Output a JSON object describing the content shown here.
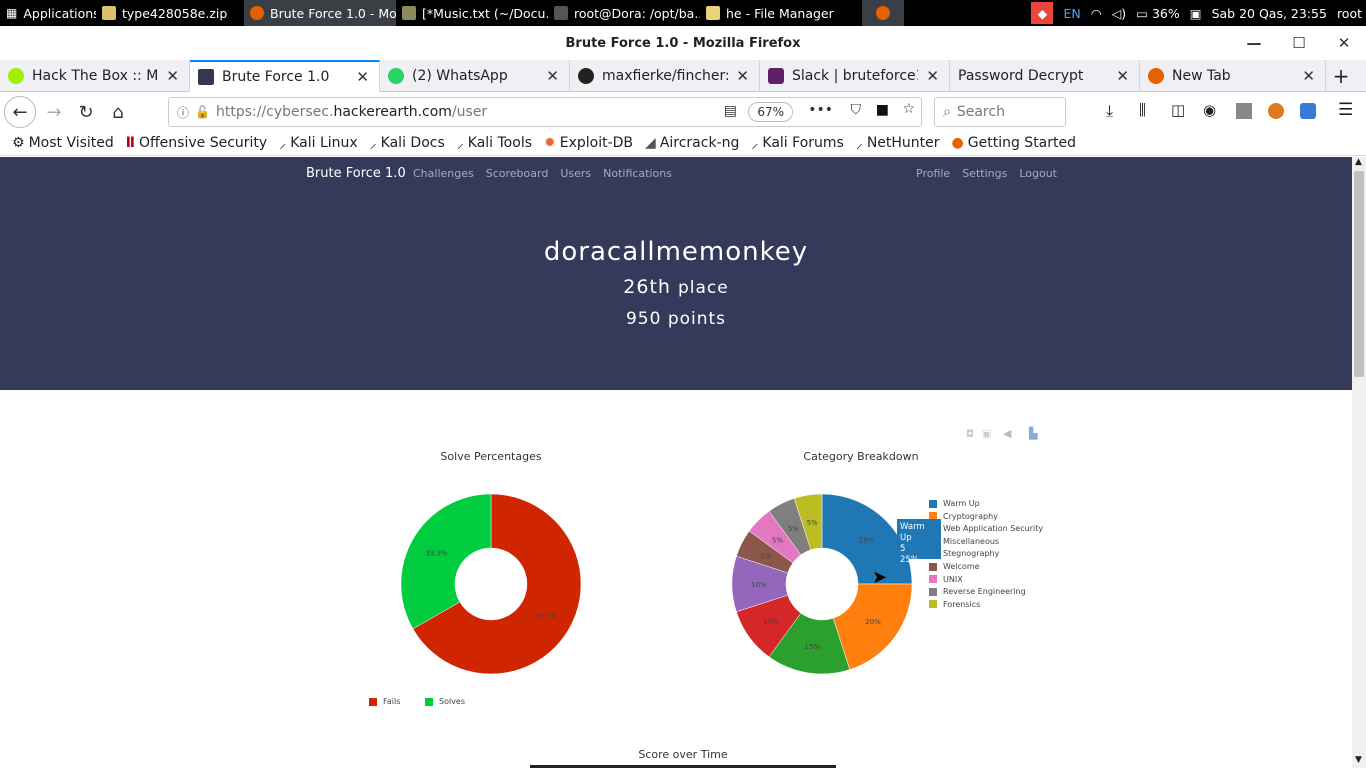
{
  "taskbar": {
    "apps_label": "Applications",
    "items": [
      {
        "label": "type428058e.zip",
        "color": "#d9c36a"
      },
      {
        "label": "Brute Force 1.0 - Mo...",
        "color": "#e66000"
      },
      {
        "label": "[*Music.txt (~/Docu...",
        "color": "#8a8a5a"
      },
      {
        "label": "root@Dora: /opt/ba...",
        "color": "#555555"
      },
      {
        "label": "he - File Manager",
        "color": "#e8d27a"
      }
    ],
    "lang": "EN",
    "battery": "36%",
    "clock": "Sab 20 Qas, 23:55",
    "user": "root"
  },
  "window": {
    "title": "Brute Force 1.0 - Mozilla Firefox"
  },
  "tabs": [
    {
      "label": "Hack The Box :: Ma",
      "color": "#9fef00"
    },
    {
      "label": "Brute Force 1.0",
      "color": "#323754"
    },
    {
      "label": "(2) WhatsApp",
      "color": "#25d366"
    },
    {
      "label": "maxfierke/fincher: A",
      "color": "#222222"
    },
    {
      "label": "Slack | bruteforce1-",
      "color": "#611f69"
    },
    {
      "label": "Password Decrypt",
      "color": ""
    },
    {
      "label": "New Tab",
      "color": "#e66000"
    }
  ],
  "url": {
    "prefix": "https://cybersec.",
    "host": "hackerearth.com",
    "path": "/user"
  },
  "zoom": "67%",
  "search_placeholder": "Search",
  "bookmarks": [
    {
      "label": "Most Visited",
      "icon": "gear-icon",
      "color": "#333333"
    },
    {
      "label": "Offensive Security",
      "icon": "offsec-icon",
      "color": "#b00020"
    },
    {
      "label": "Kali Linux",
      "icon": "kali-icon",
      "color": "#222222"
    },
    {
      "label": "Kali Docs",
      "icon": "kali-icon",
      "color": "#222222"
    },
    {
      "label": "Kali Tools",
      "icon": "kali-icon",
      "color": "#222222"
    },
    {
      "label": "Exploit-DB",
      "icon": "exploitdb-icon",
      "color": "#e8632b"
    },
    {
      "label": "Aircrack-ng",
      "icon": "aircrack-icon",
      "color": "#444444"
    },
    {
      "label": "Kali Forums",
      "icon": "kali-icon",
      "color": "#222222"
    },
    {
      "label": "NetHunter",
      "icon": "kali-icon",
      "color": "#222222"
    },
    {
      "label": "Getting Started",
      "icon": "firefox-icon",
      "color": "#e66000"
    }
  ],
  "site": {
    "brand": "Brute Force 1.0",
    "nav_left": [
      "Challenges",
      "Scoreboard",
      "Users",
      "Notifications"
    ],
    "nav_right": [
      "Profile",
      "Settings",
      "Logout"
    ],
    "username": "doracallmemonkey",
    "place_num": "26th",
    "place_unit": "place",
    "points_num": "950",
    "points_unit": "points",
    "hero_color": "#353a5a"
  },
  "charts": {
    "score_title": "Score over Time"
  },
  "tooltip": {
    "label": "Warm Up",
    "value": "5",
    "pct": "25%"
  },
  "chart_data": [
    {
      "type": "pie",
      "title": "Solve Percentages",
      "categories": [
        "Fails",
        "Solves"
      ],
      "values": [
        66.7,
        33.3
      ],
      "labels": [
        "66.7%",
        "33.3%"
      ],
      "colors": [
        "#cf2500",
        "#00cc3f"
      ],
      "legend": "bottom"
    },
    {
      "type": "pie",
      "title": "Category Breakdown",
      "categories": [
        "Warm Up",
        "Cryptography",
        "Web Application Security",
        "Miscellaneous",
        "Stegnography",
        "Welcome",
        "UNIX",
        "Reverse Engineering",
        "Forensics"
      ],
      "values": [
        25,
        20,
        15,
        10,
        10,
        5,
        5,
        5,
        5
      ],
      "labels": [
        "25%",
        "20%",
        "15%",
        "10%",
        "10%",
        "5%",
        "5%",
        "5%",
        "5%"
      ],
      "colors": [
        "#1f77b4",
        "#ff7f0e",
        "#2ca02c",
        "#d62728",
        "#9467bd",
        "#8c564b",
        "#e377c2",
        "#7f7f7f",
        "#bcbd22"
      ],
      "legend": "right"
    }
  ]
}
